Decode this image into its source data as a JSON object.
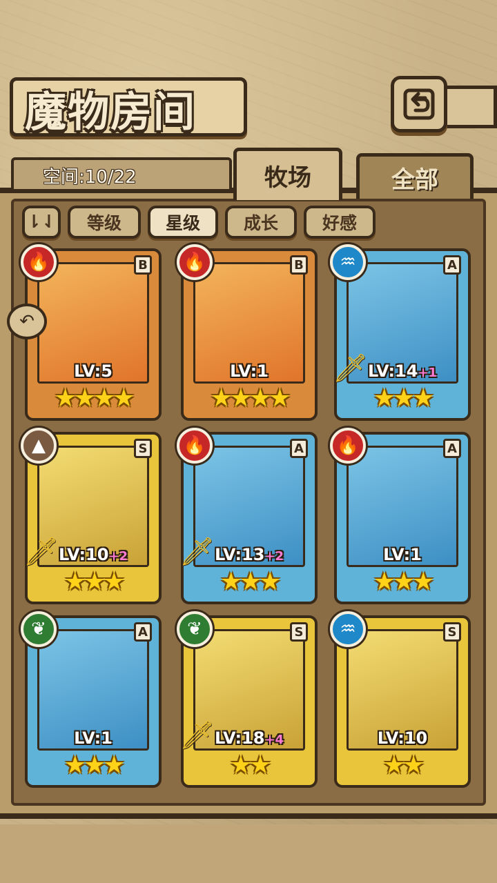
{
  "header": {
    "title": "魔物房间",
    "space_label": "空间:10/22"
  },
  "tabs": [
    {
      "label": "牧场",
      "active": true
    },
    {
      "label": "全部",
      "active": false
    }
  ],
  "filters": {
    "toggle_icon": "sort-toggle-icon",
    "items": [
      {
        "label": "等级",
        "active": false
      },
      {
        "label": "星级",
        "active": true
      },
      {
        "label": "成长",
        "active": false
      },
      {
        "label": "好感",
        "active": false
      }
    ]
  },
  "cards": [
    {
      "rank": "B",
      "element": "fire",
      "level": "LV:5",
      "plus": "",
      "stars": "★★★★",
      "frame": "orange",
      "sword": false
    },
    {
      "rank": "B",
      "element": "fire",
      "level": "LV:1",
      "plus": "",
      "stars": "★★★★",
      "frame": "orange",
      "sword": false
    },
    {
      "rank": "A",
      "element": "water",
      "level": "LV:14",
      "plus": "+1",
      "stars": "★★★",
      "frame": "blue",
      "sword": true
    },
    {
      "rank": "S",
      "element": "earth",
      "level": "LV:10",
      "plus": "+2",
      "stars": "★★★",
      "frame": "gold",
      "sword": true
    },
    {
      "rank": "A",
      "element": "fire",
      "level": "LV:13",
      "plus": "+2",
      "stars": "★★★",
      "frame": "blue",
      "sword": true
    },
    {
      "rank": "A",
      "element": "fire",
      "level": "LV:1",
      "plus": "",
      "stars": "★★★",
      "frame": "blue",
      "sword": false
    },
    {
      "rank": "A",
      "element": "leaf",
      "level": "LV:1",
      "plus": "",
      "stars": "★★★",
      "frame": "blue",
      "sword": false
    },
    {
      "rank": "S",
      "element": "leaf",
      "level": "LV:18",
      "plus": "+4",
      "stars": "★★",
      "frame": "gold",
      "sword": true
    },
    {
      "rank": "S",
      "element": "water",
      "level": "LV:10",
      "plus": "",
      "stars": "★★",
      "frame": "gold",
      "sword": false
    }
  ],
  "colors": {
    "fire": "#c62828",
    "water": "#1e88c8",
    "earth": "#7b5a42",
    "leaf": "#2e7d32"
  }
}
